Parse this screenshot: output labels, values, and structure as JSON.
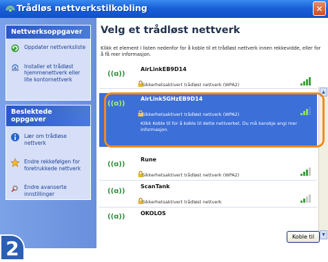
{
  "window": {
    "title": "Trådløs nettverkstilkobling",
    "close_label": "✕"
  },
  "sidebar": {
    "panels": [
      {
        "title": "Nettverksoppgaver",
        "items": [
          {
            "label": "Oppdater nettverksliste",
            "icon": "refresh-icon"
          },
          {
            "label": "Installer et trådløst hjemmenettverk eller lite kontornettverk",
            "icon": "wireless-setup-icon"
          }
        ]
      },
      {
        "title": "Beslektede oppgaver",
        "items": [
          {
            "label": "Lær om trådløse nettverk",
            "icon": "info-icon"
          },
          {
            "label": "Endre rekkefølgen for foretrukkede nettverk",
            "icon": "star-icon"
          },
          {
            "label": "Endre avanserte innstillinger",
            "icon": "settings-icon"
          }
        ]
      }
    ]
  },
  "main": {
    "heading": "Velg et trådløst nettverk",
    "description": "Klikk et element i listen nedenfor for å koble til et trådløst nettverk innen rekkevidde, eller for å få mer informasjon.",
    "networks": [
      {
        "name": "AirLinkEB9D14",
        "security": "Sikkerhetsaktivert trådløst nettverk (WPA2)",
        "signal_bars": 4,
        "selected": false
      },
      {
        "name": "AirLink5GHzEB9D14",
        "security": "Sikkerhetsaktivert trådløst nettverk (WPA2)",
        "signal_bars": 3,
        "selected": true,
        "detail": "Klikk Koble til for å koble til dette nettverket. Du må kanskje angi mer informasjon."
      },
      {
        "name": "Rune",
        "security": "Sikkerhetsaktivert trådløst nettverk (WPA2)",
        "signal_bars": 3,
        "selected": false
      },
      {
        "name": "ScanTank",
        "security": "Sikkerhetsaktivert trådløst nettverk",
        "signal_bars": 2,
        "selected": false
      },
      {
        "name": "OKOLOS",
        "security": "",
        "signal_bars": 0,
        "selected": false
      }
    ],
    "signal_glyph": "((ɑ))",
    "connect_label": "Koble til"
  },
  "step_badge": "2",
  "colors": {
    "highlight": "#f08a1d",
    "selection": "#3c6fd8",
    "title_bar": "#1a5fd8"
  }
}
